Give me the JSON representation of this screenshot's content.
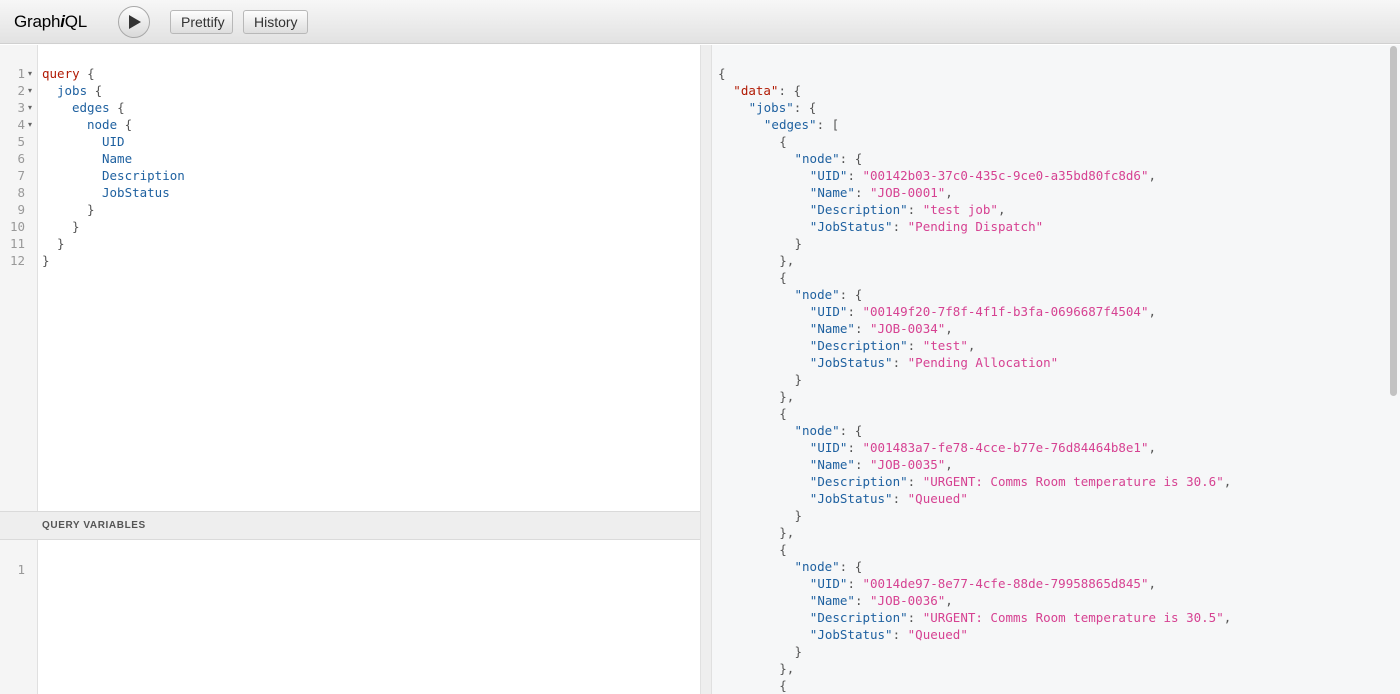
{
  "app": {
    "logo_prefix": "Graph",
    "logo_italic": "i",
    "logo_suffix": "QL",
    "prettify_label": "Prettify",
    "history_label": "History"
  },
  "query_lines": [
    {
      "n": "1",
      "fold": true,
      "indent": 0,
      "parts": [
        {
          "t": "kw",
          "v": "query"
        },
        {
          "t": "pn",
          "v": " {"
        }
      ]
    },
    {
      "n": "2",
      "fold": true,
      "indent": 1,
      "parts": [
        {
          "t": "fld",
          "v": "jobs"
        },
        {
          "t": "pn",
          "v": " {"
        }
      ]
    },
    {
      "n": "3",
      "fold": true,
      "indent": 2,
      "parts": [
        {
          "t": "fld",
          "v": "edges"
        },
        {
          "t": "pn",
          "v": " {"
        }
      ]
    },
    {
      "n": "4",
      "fold": true,
      "indent": 3,
      "parts": [
        {
          "t": "fld",
          "v": "node"
        },
        {
          "t": "pn",
          "v": " {"
        }
      ]
    },
    {
      "n": "5",
      "fold": false,
      "indent": 4,
      "parts": [
        {
          "t": "fld",
          "v": "UID"
        }
      ]
    },
    {
      "n": "6",
      "fold": false,
      "indent": 4,
      "parts": [
        {
          "t": "fld",
          "v": "Name"
        }
      ]
    },
    {
      "n": "7",
      "fold": false,
      "indent": 4,
      "parts": [
        {
          "t": "fld",
          "v": "Description"
        }
      ]
    },
    {
      "n": "8",
      "fold": false,
      "indent": 4,
      "parts": [
        {
          "t": "fld",
          "v": "JobStatus"
        }
      ]
    },
    {
      "n": "9",
      "fold": false,
      "indent": 3,
      "parts": [
        {
          "t": "pn",
          "v": "}"
        }
      ]
    },
    {
      "n": "10",
      "fold": false,
      "indent": 2,
      "parts": [
        {
          "t": "pn",
          "v": "}"
        }
      ]
    },
    {
      "n": "11",
      "fold": false,
      "indent": 1,
      "parts": [
        {
          "t": "pn",
          "v": "}"
        }
      ]
    },
    {
      "n": "12",
      "fold": false,
      "indent": 0,
      "parts": [
        {
          "t": "pn",
          "v": "}"
        }
      ]
    }
  ],
  "variables": {
    "title": "QUERY VARIABLES",
    "line_number": "1"
  },
  "result": {
    "jobs": [
      {
        "UID": "00142b03-37c0-435c-9ce0-a35bd80fc8d6",
        "Name": "JOB-0001",
        "Description": "test job",
        "JobStatus": "Pending Dispatch"
      },
      {
        "UID": "00149f20-7f8f-4f1f-b3fa-0696687f4504",
        "Name": "JOB-0034",
        "Description": "test",
        "JobStatus": "Pending Allocation"
      },
      {
        "UID": "001483a7-fe78-4cce-b77e-76d84464b8e1",
        "Name": "JOB-0035",
        "Description": "URGENT: Comms Room temperature is 30.6",
        "JobStatus": "Queued"
      },
      {
        "UID": "0014de97-8e77-4cfe-88de-79958865d845",
        "Name": "JOB-0036",
        "Description": "URGENT: Comms Room temperature is 30.5",
        "JobStatus": "Queued"
      }
    ]
  }
}
